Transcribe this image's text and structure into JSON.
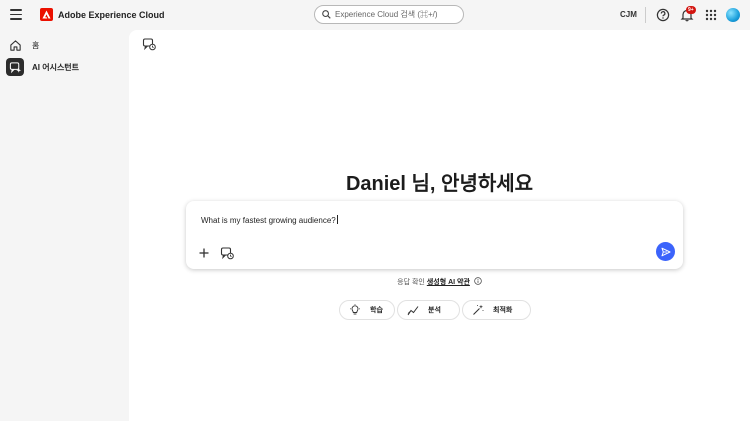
{
  "header": {
    "brand": "Adobe Experience Cloud",
    "search_placeholder": "Experience Cloud 검색 (⌘+/)",
    "org": "CJM",
    "notification_badge": "9+"
  },
  "sidebar": {
    "items": [
      {
        "label": "홈",
        "icon": "home-icon"
      },
      {
        "label": "AI 어시스턴트",
        "icon": "ai-assistant-icon",
        "selected": true
      }
    ]
  },
  "main": {
    "greeting": "Daniel 님, 안녕하세요",
    "prompt_value": "What is my fastest growing audience?",
    "disclaimer_prefix": "응답 확인",
    "disclaimer_link": "생성형 AI 약관",
    "chips": [
      {
        "label": "학습",
        "icon": "lightbulb-icon"
      },
      {
        "label": "분석",
        "icon": "trend-icon"
      },
      {
        "label": "최적화",
        "icon": "magic-wand-icon"
      }
    ]
  },
  "colors": {
    "brand_red": "#eb1000",
    "send_blue": "#3b63fb",
    "badge_red": "#d31510"
  }
}
